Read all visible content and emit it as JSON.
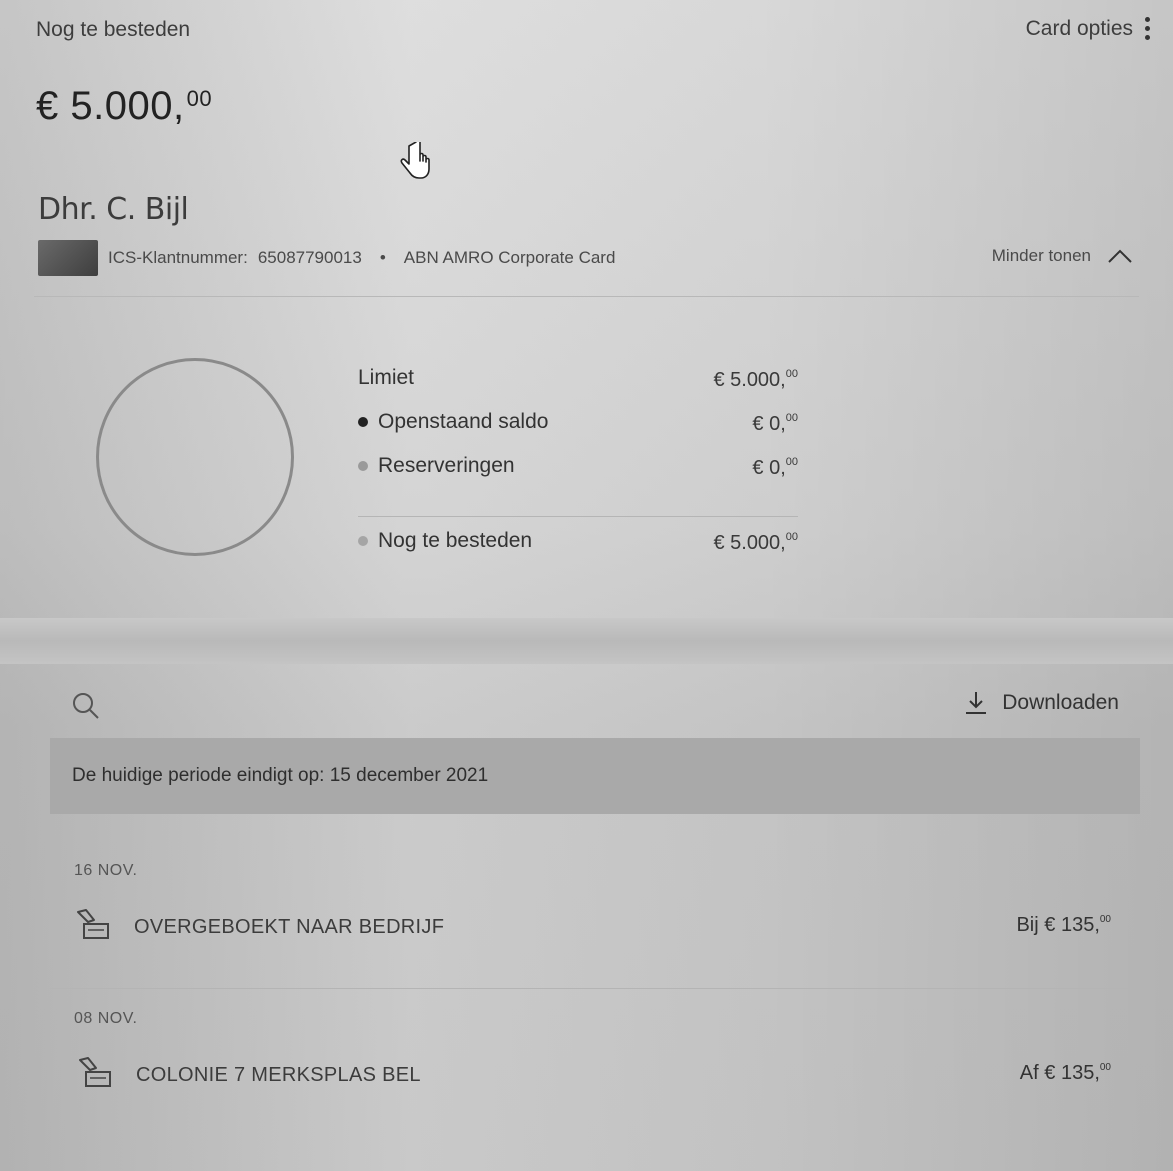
{
  "header": {
    "remaining_label": "Nog te besteden",
    "remaining_amount": "€ 5.000,",
    "remaining_cents": "00",
    "card_options_label": "Card opties"
  },
  "account": {
    "holder_name": "Dhr. C. Bijl",
    "customer_number_label": "ICS-Klantnummer:",
    "customer_number": "65087790013",
    "card_name": "ABN AMRO Corporate Card",
    "toggle_label": "Minder tonen"
  },
  "summary": {
    "rows": [
      {
        "label": "Limiet",
        "amount": "€ 5.000,",
        "cents": "00"
      },
      {
        "label": "Openstaand saldo",
        "amount": "€ 0,",
        "cents": "00"
      },
      {
        "label": "Reserveringen",
        "amount": "€ 0,",
        "cents": "00"
      },
      {
        "label": "Nog te besteden",
        "amount": "€ 5.000,",
        "cents": "00"
      }
    ]
  },
  "toolbar": {
    "download_label": "Downloaden"
  },
  "period": {
    "text": "De huidige periode eindigt op: 15 december 2021"
  },
  "transactions": [
    {
      "date": "16 NOV.",
      "description": "OVERGEBOEKT NAAR BEDRIJF",
      "direction": "Bij",
      "amount": "€ 135,",
      "cents": "00"
    },
    {
      "date": "08 NOV.",
      "description": "COLONIE 7 MERKSPLAS BEL",
      "direction": "Af",
      "amount": "€ 135,",
      "cents": "00"
    }
  ],
  "icons": {
    "card_options": "kebab-menu-icon",
    "toggle": "chevron-up-icon",
    "search": "search-icon",
    "download": "download-icon",
    "transaction": "transfer-icon"
  },
  "colors": {
    "openstaand_dot": "#222222",
    "reserveringen_dot": "#9a9a9a",
    "nog_te_besteden_dot": "#a5a5a5"
  }
}
